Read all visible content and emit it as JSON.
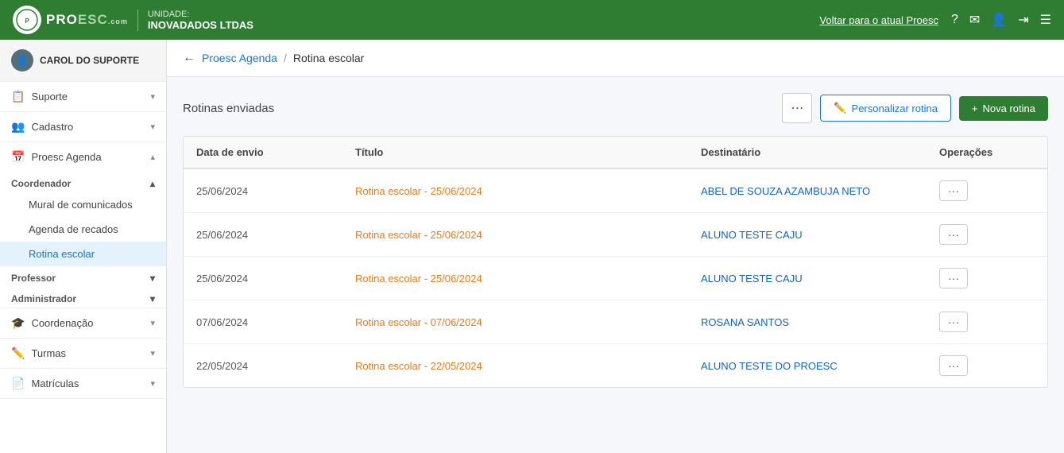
{
  "header": {
    "unit_label": "UNIDADE:",
    "unit_name": "INOVADADOS LTDAS",
    "voltar_text": "Voltar para o atual Proesc",
    "icons": [
      "question-icon",
      "mail-icon",
      "user-icon",
      "logout-icon",
      "menu-icon"
    ]
  },
  "logo": {
    "text": "PROESC",
    "sub": ".com"
  },
  "sidebar": {
    "username": "CAROL DO SUPORTE",
    "items": [
      {
        "id": "suporte",
        "label": "Suporte",
        "icon": "📋",
        "expandable": true
      },
      {
        "id": "cadastro",
        "label": "Cadastro",
        "icon": "👥",
        "expandable": true
      },
      {
        "id": "proesc-agenda",
        "label": "Proesc Agenda",
        "icon": "📅",
        "expandable": true
      },
      {
        "id": "coordenador",
        "label": "Coordenador",
        "expandable": true,
        "group": true,
        "subitems": [
          {
            "id": "mural",
            "label": "Mural de comunicados",
            "active": false
          },
          {
            "id": "agenda-recados",
            "label": "Agenda de recados",
            "active": false
          },
          {
            "id": "rotina-escolar",
            "label": "Rotina escolar",
            "active": true
          }
        ]
      },
      {
        "id": "professor",
        "label": "Professor",
        "expandable": true,
        "group": true
      },
      {
        "id": "administrador",
        "label": "Administrador",
        "expandable": true,
        "group": true
      },
      {
        "id": "coordenacao",
        "label": "Coordenação",
        "icon": "🎓",
        "expandable": true
      },
      {
        "id": "turmas",
        "label": "Turmas",
        "icon": "✏️",
        "expandable": true
      },
      {
        "id": "matriculas",
        "label": "Matrículas",
        "icon": "📄",
        "expandable": true
      }
    ]
  },
  "breadcrumb": {
    "back_label": "←",
    "parent": "Proesc Agenda",
    "separator": "/",
    "current": "Rotina escolar"
  },
  "page": {
    "section_title": "Rotinas enviadas",
    "btn_dots_label": "⋯",
    "btn_personalizar_label": "Personalizar rotina",
    "btn_nova_label": "Nova rotina",
    "table": {
      "columns": [
        "Data de envio",
        "Título",
        "Destinatário",
        "Operações"
      ],
      "rows": [
        {
          "date": "25/06/2024",
          "title": "Rotina escolar - 25/06/2024",
          "dest": "ABEL DE SOUZA AZAMBUJA NETO",
          "ops": "···"
        },
        {
          "date": "25/06/2024",
          "title": "Rotina escolar - 25/06/2024",
          "dest": "ALUNO TESTE CAJU",
          "ops": "···"
        },
        {
          "date": "25/06/2024",
          "title": "Rotina escolar - 25/06/2024",
          "dest": "ALUNO TESTE CAJU",
          "ops": "···"
        },
        {
          "date": "07/06/2024",
          "title": "Rotina escolar - 07/06/2024",
          "dest": "ROSANA SANTOS",
          "ops": "···"
        },
        {
          "date": "22/05/2024",
          "title": "Rotina escolar - 22/05/2024",
          "dest": "ALUNO TESTE DO PROESC",
          "ops": "···"
        }
      ]
    }
  }
}
